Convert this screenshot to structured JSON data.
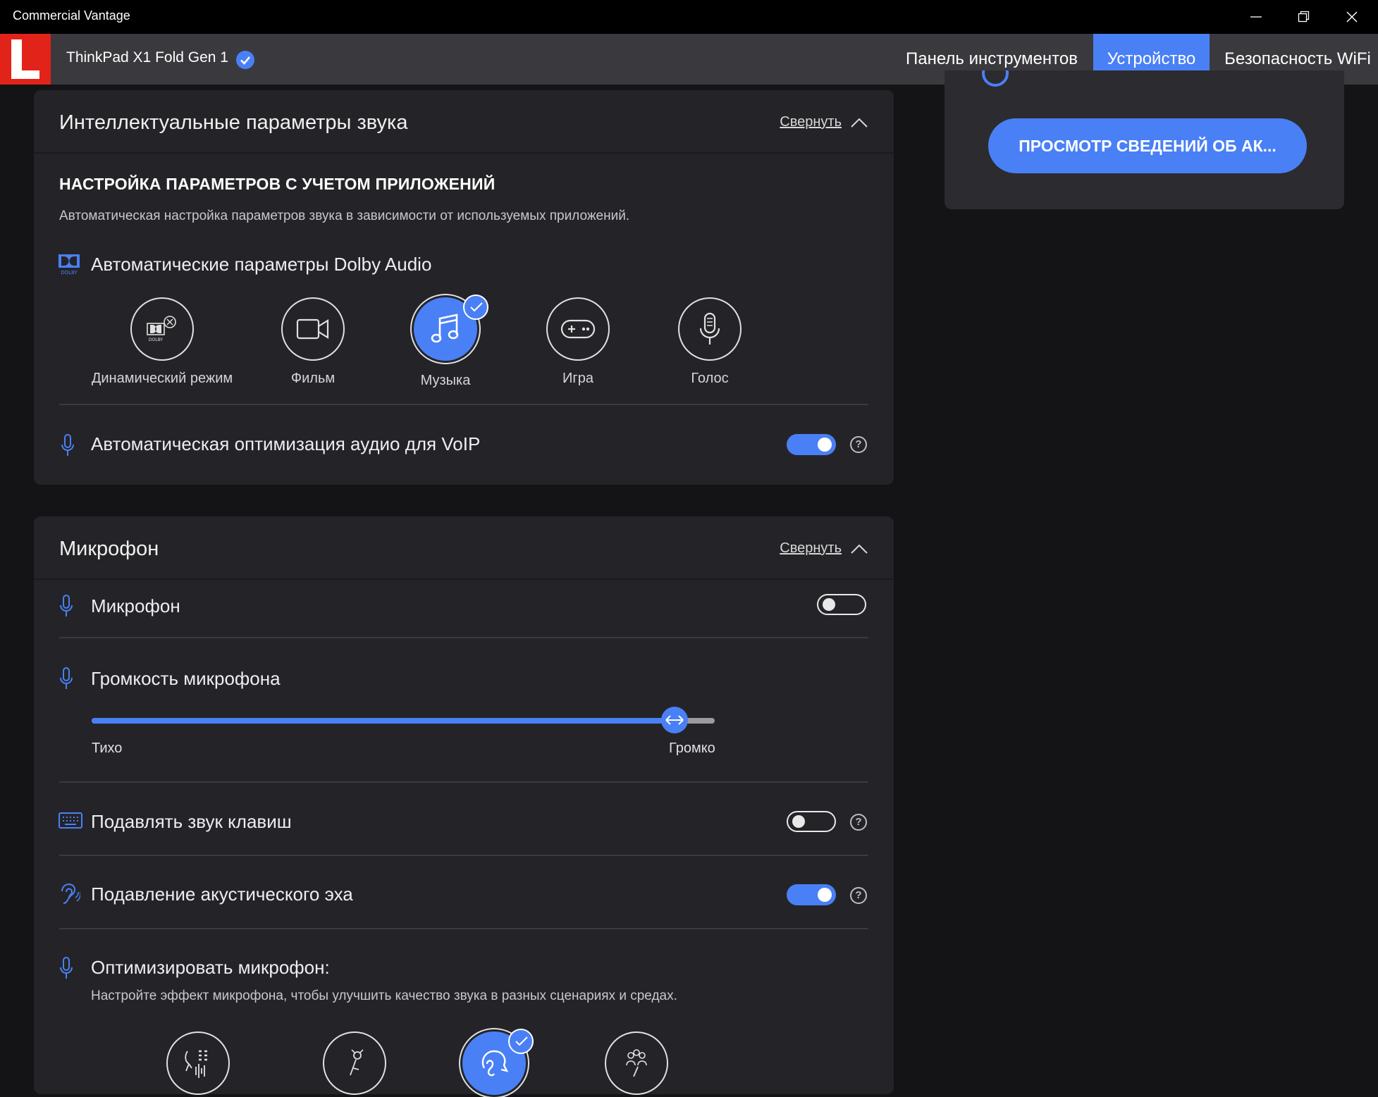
{
  "window": {
    "title": "Commercial Vantage"
  },
  "header": {
    "device_name": "ThinkPad X1 Fold Gen 1",
    "nav": {
      "dashboard": "Панель инструментов",
      "device": "Устройство",
      "wifi_security": "Безопасность WiFi"
    },
    "active_tab": "device"
  },
  "battery_card": {
    "button_label": "ПРОСМОТР СВЕДЕНИЙ ОБ АК..."
  },
  "smart_sound": {
    "title": "Интеллектуальные параметры звука",
    "collapse_label": "Свернуть",
    "section_heading": "НАСТРОЙКА ПАРАМЕТРОВ С УЧЕТОМ ПРИЛОЖЕНИЙ",
    "section_description": "Автоматическая настройка параметров звука в зависимости от используемых приложений.",
    "dolby_label": "Автоматические параметры Dolby Audio",
    "modes": [
      {
        "label": "Динамический режим",
        "icon": "dolby-dynamic-icon",
        "selected": false
      },
      {
        "label": "Фильм",
        "icon": "video-camera-icon",
        "selected": false
      },
      {
        "label": "Музыка",
        "icon": "music-note-icon",
        "selected": true
      },
      {
        "label": "Игра",
        "icon": "gamepad-icon",
        "selected": false
      },
      {
        "label": "Голос",
        "icon": "microphone-icon",
        "selected": false
      }
    ],
    "voip_label": "Автоматическая оптимизация аудио для VoIP",
    "voip_enabled": true
  },
  "microphone": {
    "title": "Микрофон",
    "collapse_label": "Свернуть",
    "mic_label": "Микрофон",
    "mic_enabled": false,
    "volume_label": "Громкость микрофона",
    "volume_fraction": 0.935,
    "volume_min_label": "Тихо",
    "volume_max_label": "Громко",
    "keyboard_noise_label": "Подавлять звук клавиш",
    "keyboard_noise_enabled": false,
    "echo_label": "Подавление акустического эха",
    "echo_enabled": true,
    "optimize_label": "Оптимизировать микрофон:",
    "optimize_description": "Настройте эффект микрофона, чтобы улучшить качество звука в разных сценариях и средах.",
    "optimize_modes": [
      {
        "icon": "voice-recognition-icon",
        "selected": false
      },
      {
        "icon": "single-voice-icon",
        "selected": false
      },
      {
        "icon": "conversation-icon",
        "selected": true
      },
      {
        "icon": "multiple-voices-icon",
        "selected": false
      }
    ]
  },
  "colors": {
    "accent": "#4a80f5",
    "background": "#141416",
    "card": "#242428",
    "lenovo_red": "#e2231a"
  }
}
